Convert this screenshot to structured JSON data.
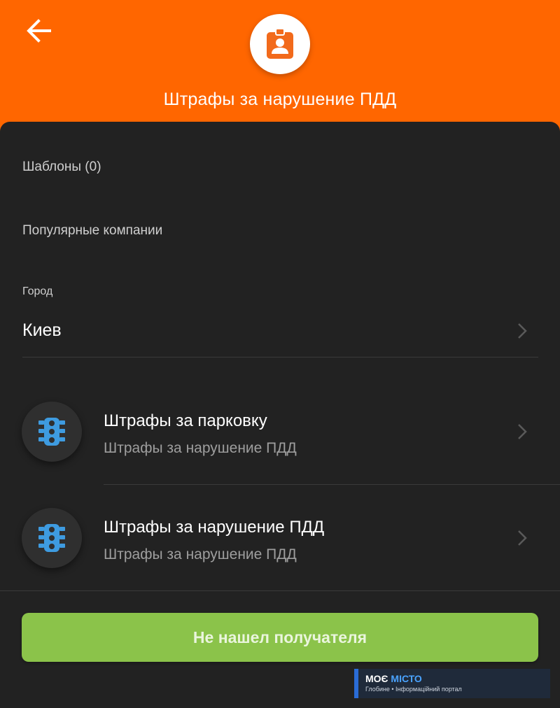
{
  "colors": {
    "header_bg": "#FF6600",
    "sheet_bg": "#222222",
    "cta_bg": "#8BC34A",
    "icon_blue": "#3E9BE0"
  },
  "header": {
    "back_icon": "arrow-left-icon",
    "logo_icon": "id-badge-icon",
    "title": "Штрафы за нарушение ПДД"
  },
  "sections": {
    "templates_label": "Шаблоны (0)",
    "popular_label": "Популярные компании"
  },
  "city": {
    "caption": "Город",
    "value": "Киев",
    "icon": "chevron-right-icon"
  },
  "companies": [
    {
      "name": "Штрафы за парковку",
      "subtitle": "Штрафы за нарушение ПДД",
      "icon": "traffic-light-icon"
    },
    {
      "name": "Штрафы за нарушение ПДД",
      "subtitle": "Штрафы за нарушение ПДД",
      "icon": "traffic-light-icon"
    }
  ],
  "cta": {
    "label": "Не нашел получателя"
  },
  "watermark": {
    "brand_part1": "МОЄ",
    "brand_part2": "МІСТО",
    "tagline": "Глобине • Інформаційний портал"
  }
}
